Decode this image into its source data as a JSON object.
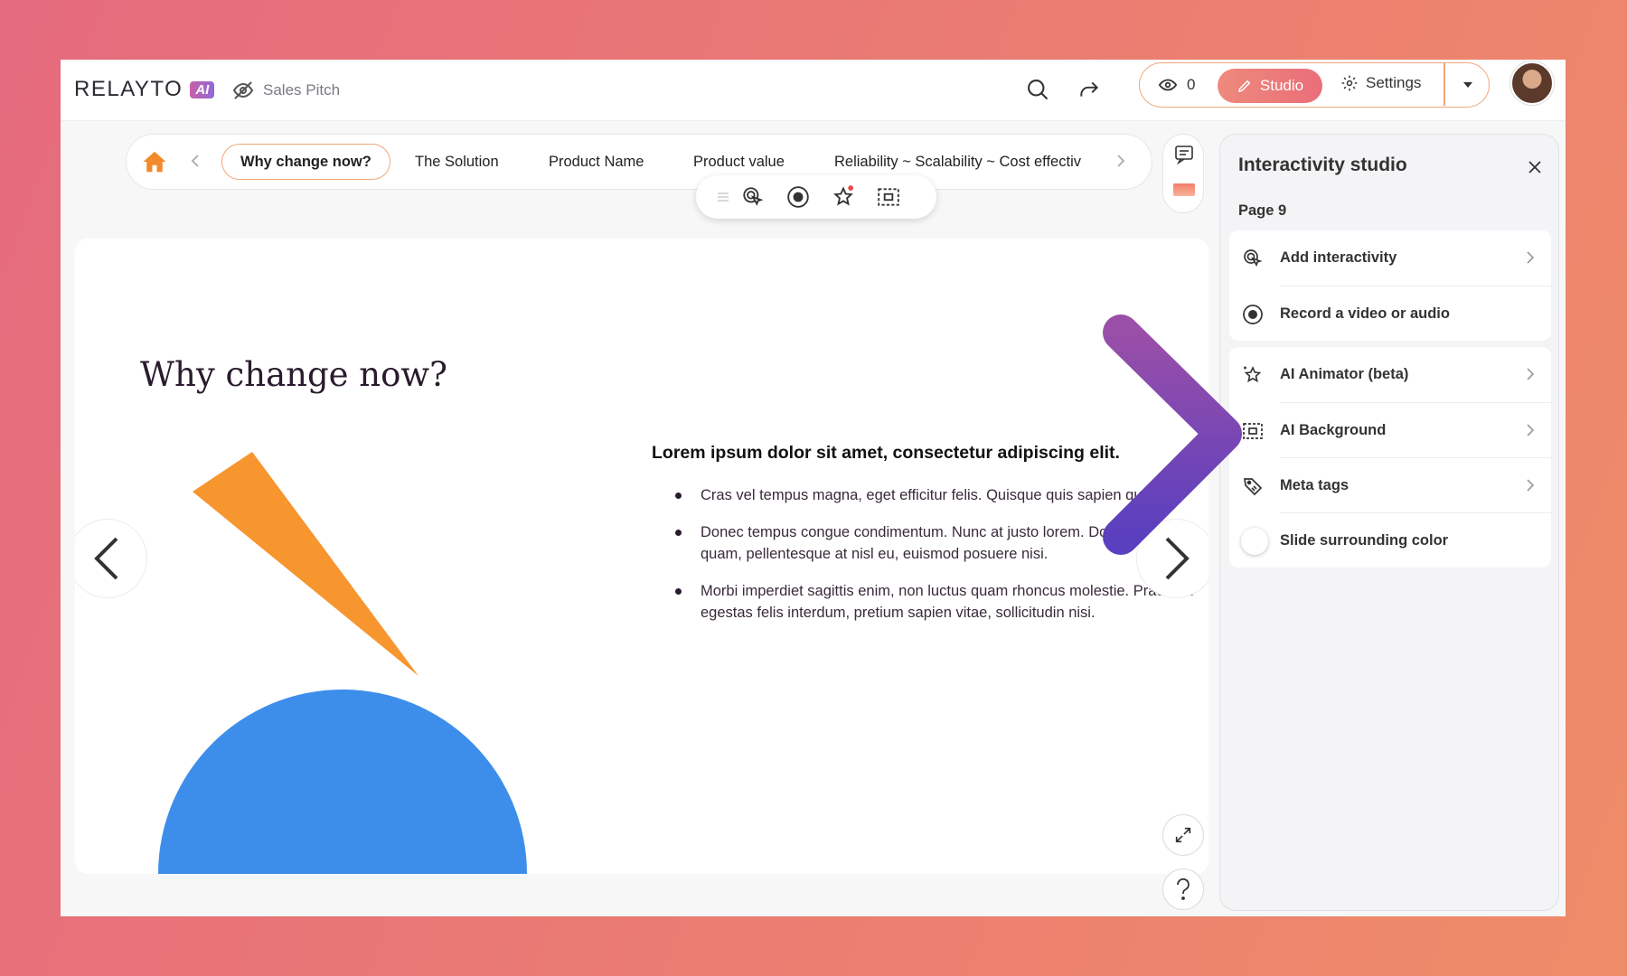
{
  "app": {
    "logo_text": "RELAYTO",
    "logo_badge": "AI",
    "doc_title": "Sales Pitch"
  },
  "toolbar": {
    "view_count": "0",
    "studio_label": "Studio",
    "settings_label": "Settings"
  },
  "slide_nav": {
    "tabs": [
      {
        "label": "Why change now?",
        "active": true
      },
      {
        "label": "The Solution"
      },
      {
        "label": "Product Name"
      },
      {
        "label": "Product value"
      },
      {
        "label": "Reliability ~ Scalability ~ Cost effectiv"
      }
    ]
  },
  "slide": {
    "title": "Why change now?",
    "heading": "Lorem ipsum dolor sit amet, consectetur adipiscing elit.",
    "bullets": [
      "Cras vel tempus magna, eget efficitur felis. Quisque quis sapien quam.",
      "Donec tempus congue condimentum. Nunc at justo lorem. Donec erat quam, pellentesque at nisl eu, euismod posuere nisi.",
      "Morbi imperdiet sagittis enim, non luctus quam rhoncus molestie. Praesent egestas felis interdum, pretium sapien vitae, sollicitudin nisi."
    ]
  },
  "panel": {
    "title": "Interactivity studio",
    "page_label": "Page 9",
    "group1": [
      {
        "label": "Add interactivity",
        "icon": "touch-icon"
      },
      {
        "label": "Record a video or audio",
        "icon": "record-icon"
      }
    ],
    "group2": [
      {
        "label": "AI Animator (beta)",
        "icon": "sparkle-star-icon"
      },
      {
        "label": "AI Background",
        "icon": "ai-background-icon"
      },
      {
        "label": "Meta tags",
        "icon": "tag-icon"
      },
      {
        "label": "Slide surrounding color",
        "icon": "toggle-icon"
      }
    ]
  },
  "colors": {
    "accent": "#ea6e79",
    "orange_shape": "#f7952e",
    "blue_shape": "#3d8eeb",
    "arrow_start": "#f47f98",
    "arrow_end": "#5a3fbf"
  }
}
